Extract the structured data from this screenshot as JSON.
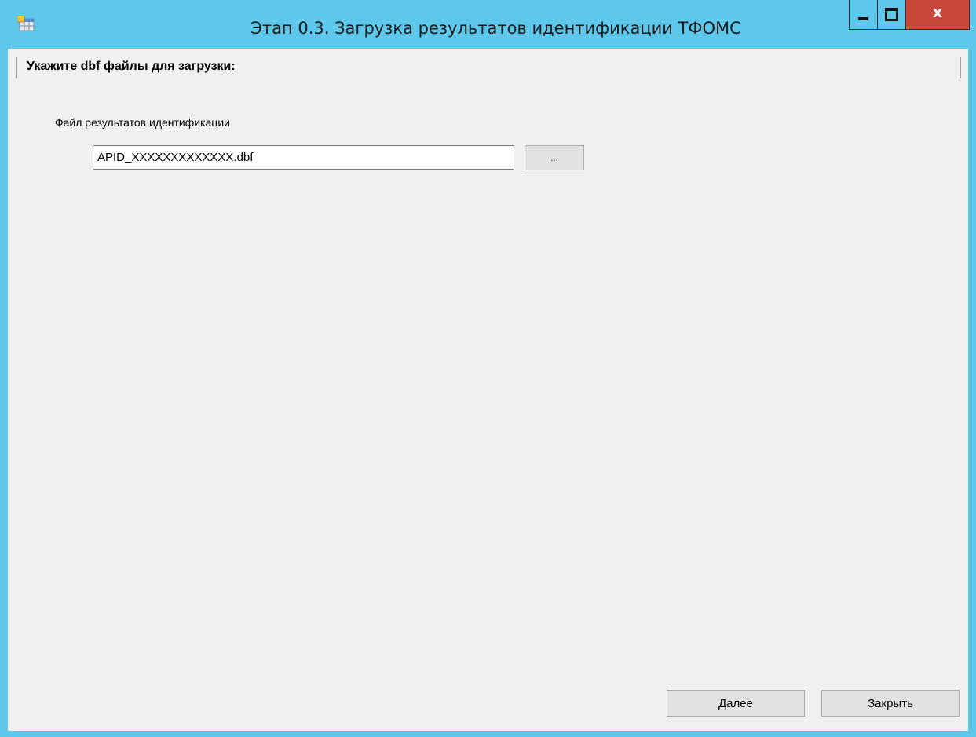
{
  "window": {
    "title": "Этап 0.3. Загрузка результатов идентификации ТФОМС",
    "app_icon": "table-app-icon",
    "controls": {
      "minimize_icon": "minimize-icon",
      "maximize_icon": "maximize-icon",
      "close_label": "x"
    }
  },
  "header": {
    "text": "Укажите dbf файлы для загрузки:"
  },
  "form": {
    "file_label": "Файл результатов идентификации",
    "file_value": "APID_XXXXXXXXXXXXX.dbf",
    "browse_label": "..."
  },
  "footer": {
    "next_label": "Далее",
    "close_label": "Закрыть"
  },
  "colors": {
    "titlebar": "#5ec8ec",
    "close_button": "#c8463a",
    "client_bg": "#f0f0f0"
  }
}
